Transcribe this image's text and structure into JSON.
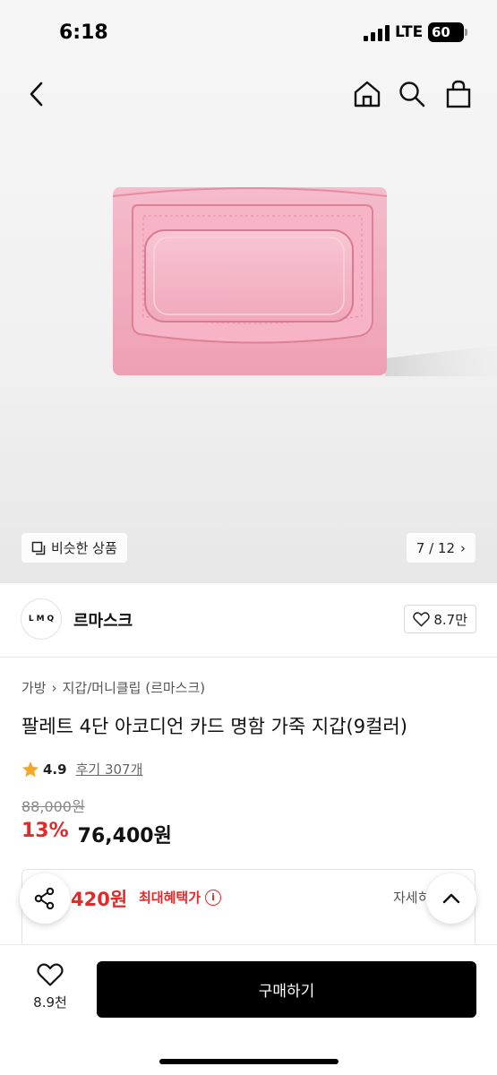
{
  "status_bar": {
    "time": "6:18",
    "network": "LTE",
    "battery": "60"
  },
  "nav": {
    "back_icon": "chevron-left-icon",
    "home_icon": "home-icon",
    "search_icon": "search-icon",
    "bag_icon": "shopping-bag-icon"
  },
  "gallery": {
    "similar_label": "비슷한 상품",
    "page_counter": "7 / 12",
    "product_color": "#f1b2c4"
  },
  "brand": {
    "logo_text": "LMQ",
    "name": "르마스크",
    "likes": "8.7만"
  },
  "breadcrumb": {
    "category": "가방",
    "subcategory": "지갑/머니클립 (르마스크)"
  },
  "product": {
    "title": "팔레트 4단 아코디언 카드 명함 가죽 지갑(9컬러)",
    "rating": "4.9",
    "reviews": "후기 307개",
    "original_price": "88,000원",
    "discount": "13%",
    "price": "76,400원"
  },
  "benefit": {
    "price": "420원",
    "label": "최대혜택가",
    "info_icon": "i",
    "detail": "자세히"
  },
  "bottom": {
    "wish_count": "8.9천",
    "buy_label": "구매하기"
  },
  "colors": {
    "accent_red": "#e22a2a",
    "buy_button": "#000000"
  }
}
